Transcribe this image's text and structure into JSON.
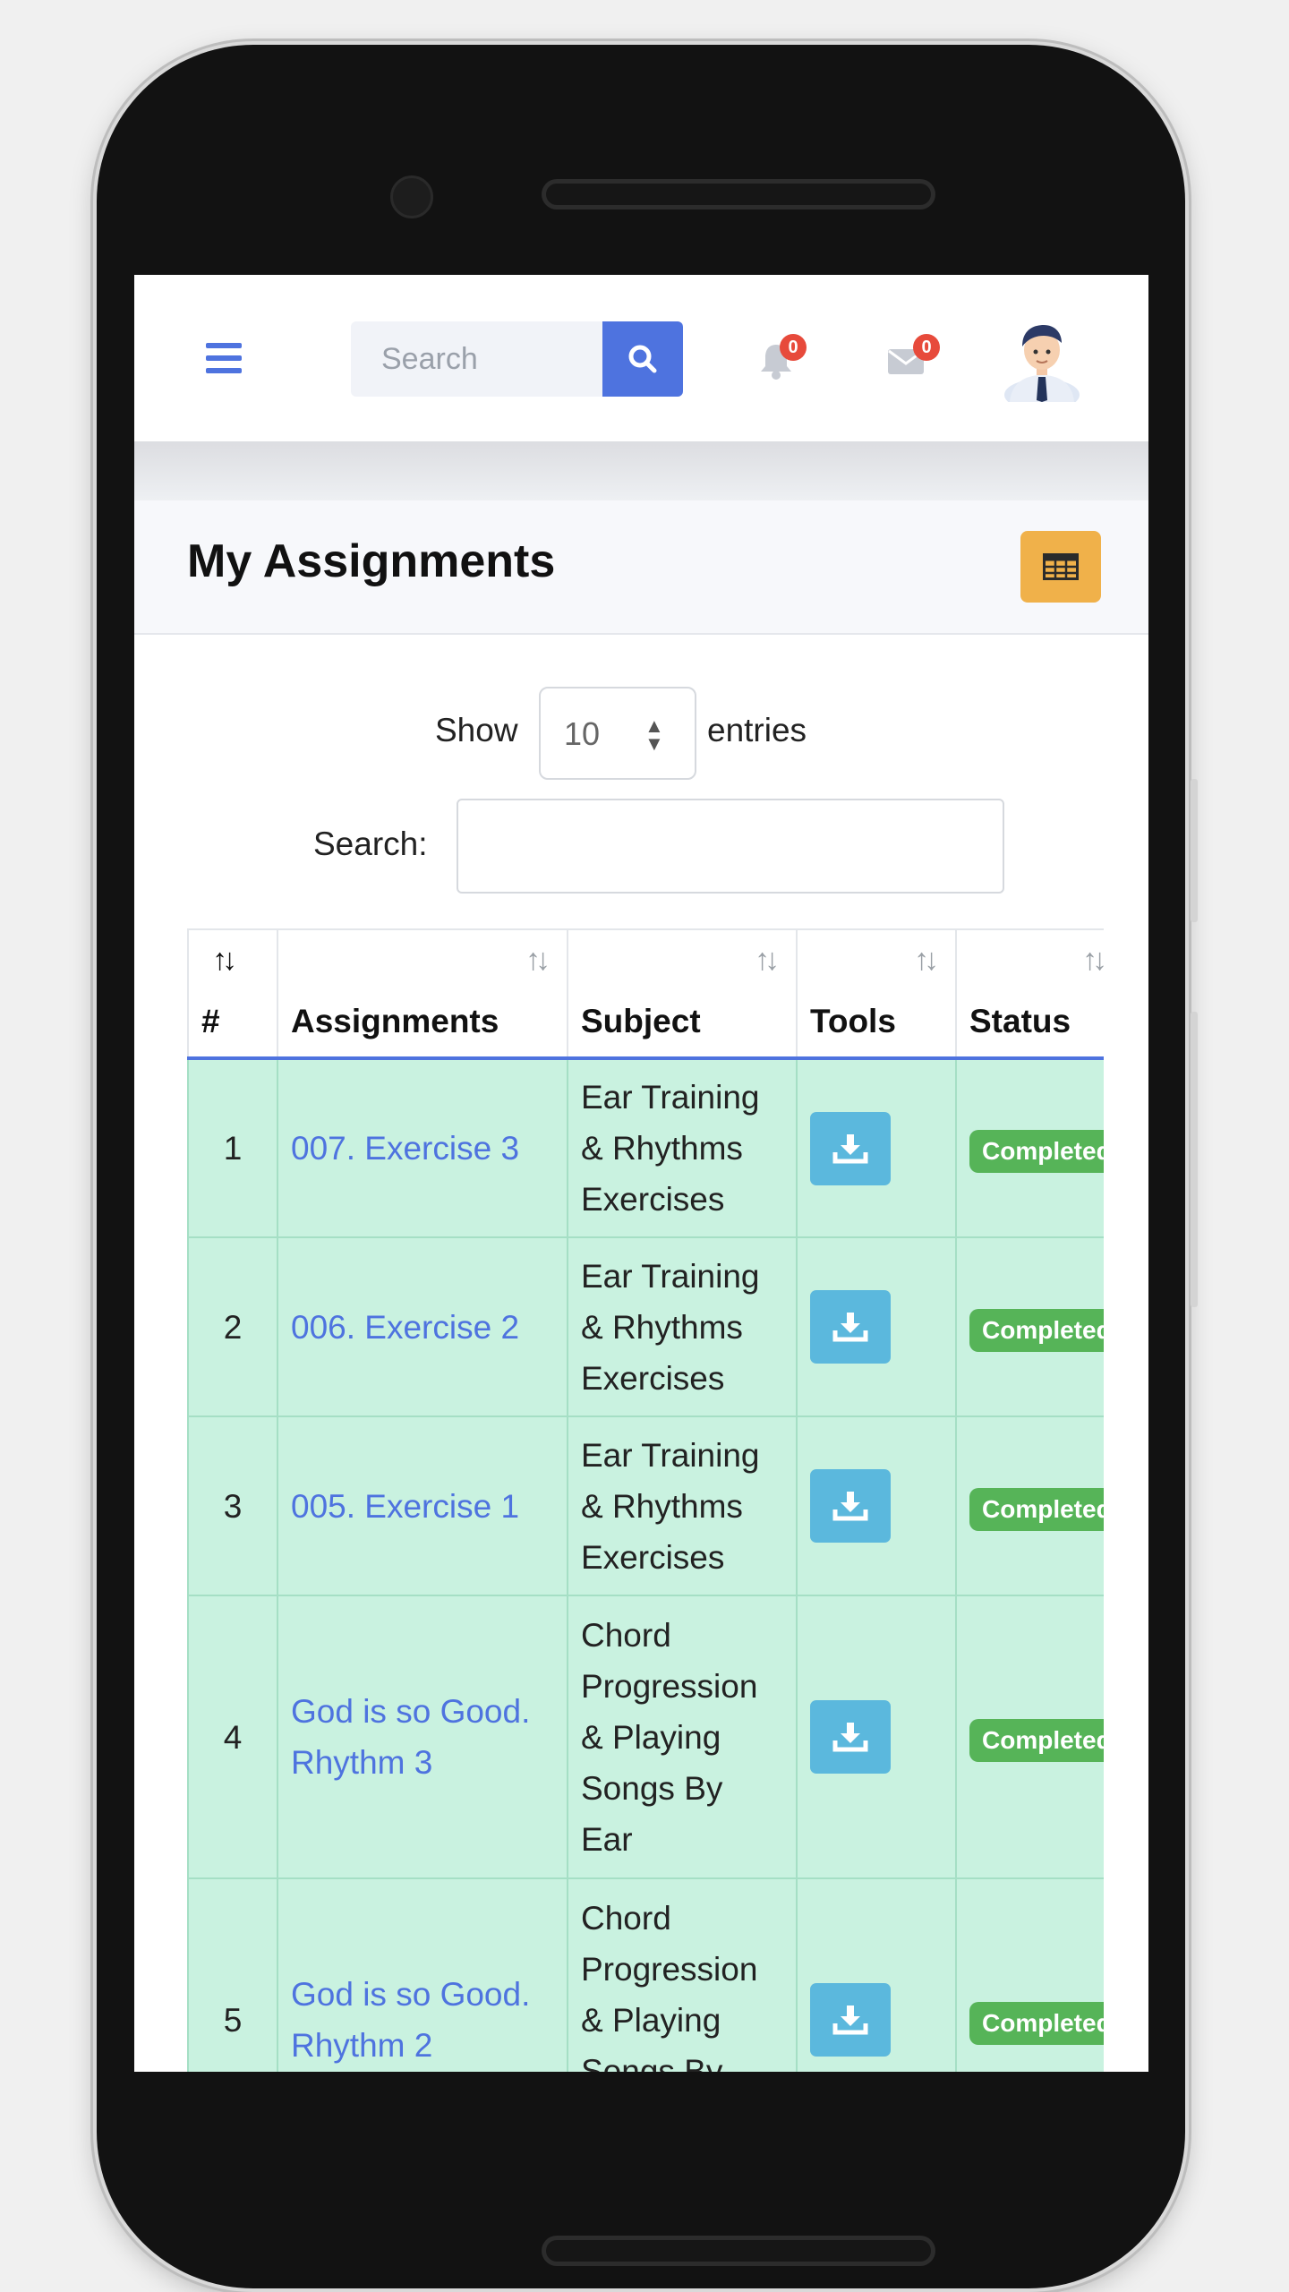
{
  "header": {
    "search_placeholder": "Search",
    "notifications_count": "0",
    "messages_count": "0"
  },
  "page": {
    "title": "My Assignments"
  },
  "controls": {
    "show_label": "Show",
    "entries_value": "10",
    "entries_label": "entries",
    "search_label": "Search:"
  },
  "table": {
    "columns": [
      "#",
      "Assignments",
      "Subject",
      "Tools",
      "Status"
    ],
    "rows": [
      {
        "num": "1",
        "assignment": "007. Exercise 3",
        "subject": "Ear Training & Rhythms Exercises",
        "status": "Completed"
      },
      {
        "num": "2",
        "assignment": "006. Exercise 2",
        "subject": "Ear Training & Rhythms Exercises",
        "status": "Completed"
      },
      {
        "num": "3",
        "assignment": "005. Exercise 1",
        "subject": "Ear Training & Rhythms Exercises",
        "status": "Completed"
      },
      {
        "num": "4",
        "assignment": "God is so Good. Rhythm 3",
        "subject": "Chord Progression & Playing Songs By Ear",
        "status": "Completed"
      },
      {
        "num": "5",
        "assignment": "God is so Good. Rhythm 2",
        "subject": "Chord Progression & Playing Songs By Ear",
        "status": "Completed"
      }
    ]
  },
  "colors": {
    "accent": "#4e73df",
    "row_bg": "#c9f2e0",
    "status_green": "#56b458",
    "tools_button": "#5bb8dd",
    "table_icon_button": "#f0b14a"
  }
}
